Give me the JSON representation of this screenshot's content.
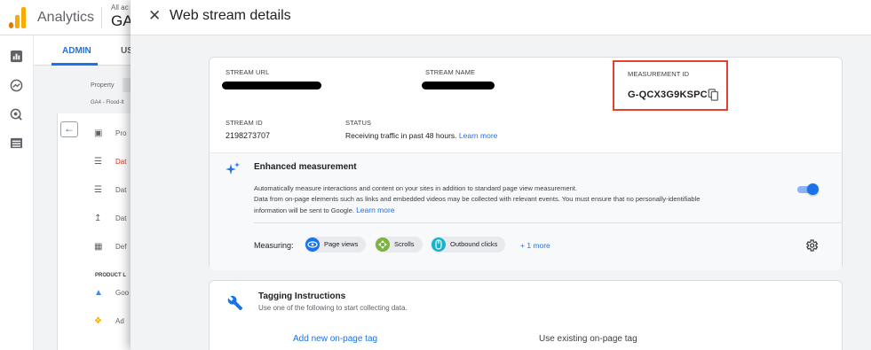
{
  "shell": {
    "app_title": "Analytics",
    "account_small": "All ac",
    "account_big": "GA",
    "tabs": [
      {
        "label": "ADMIN"
      },
      {
        "label": "US"
      }
    ],
    "property_label": "Property",
    "property_name": "GA4 - Flood-It",
    "side_items": [
      {
        "label": "Pro"
      },
      {
        "label": "Dat"
      },
      {
        "label": "Dat"
      },
      {
        "label": "Dat"
      },
      {
        "label": "Def"
      }
    ],
    "product_label": "PRODUCT L",
    "product_items": [
      {
        "label": "Goo"
      },
      {
        "label": "Ad"
      }
    ]
  },
  "dialog": {
    "title": "Web stream details",
    "stream_url_label": "STREAM URL",
    "stream_name_label": "STREAM NAME",
    "measurement_id_label": "MEASUREMENT ID",
    "measurement_id": "G-QCX3G9KSPC",
    "stream_id_label": "STREAM ID",
    "stream_id": "2198273707",
    "status_label": "STATUS",
    "status_text": "Receiving traffic in past 48 hours.",
    "status_link": "Learn more",
    "enhanced": {
      "title": "Enhanced measurement",
      "desc_line1": "Automatically measure interactions and content on your sites in addition to standard page view measurement.",
      "desc_line2": "Data from on-page elements such as links and embedded videos may be collected with relevant events. You must ensure that no personally-identifiable",
      "desc_line3": "information will be sent to Google.",
      "learn_more": "Learn more",
      "measuring_label": "Measuring:",
      "chips": [
        {
          "label": "Page views",
          "color": "#1a73e8"
        },
        {
          "label": "Scrolls",
          "color": "#7cb342"
        },
        {
          "label": "Outbound clicks",
          "color": "#12b5cb"
        }
      ],
      "more": "+ 1 more",
      "enabled": true
    },
    "tagging": {
      "title": "Tagging Instructions",
      "subtitle": "Use one of the following to start collecting data.",
      "option_add": "Add new on-page tag",
      "option_existing": "Use existing on-page tag"
    }
  },
  "colors": {
    "accent": "#1a73e8",
    "highlight_box": "#e8402e",
    "logo_orange": "#f9ab00",
    "logo_dark_orange": "#e37400"
  }
}
